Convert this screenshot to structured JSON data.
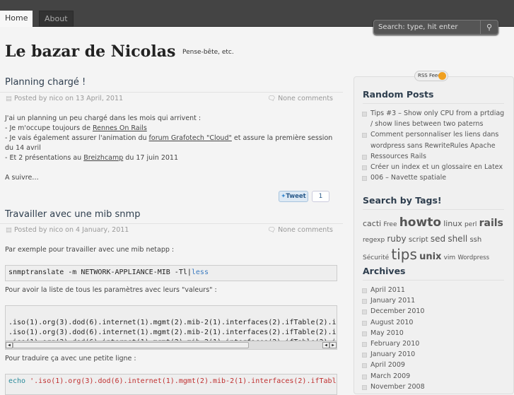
{
  "nav": {
    "tabs": [
      {
        "label": "Home",
        "active": true
      },
      {
        "label": "About"
      }
    ]
  },
  "search": {
    "placeholder": "Search: type, hit enter",
    "icon": "search-icon"
  },
  "site": {
    "title": "Le bazar de Nicolas",
    "tagline": "Pense-bête, etc."
  },
  "posts": [
    {
      "title": "Planning chargé !",
      "meta": "Posted by nico on 13 April, 2011",
      "comments": "None comments",
      "p1": "J'ai un planning un peu chargé dans les mois qui arrivent :",
      "l1a": "- Je m'occupe toujours de ",
      "l1link": "Rennes On Rails",
      "l2a": "- Je vais également assurer l'animation du ",
      "l2link": "forum Grafotech \"Cloud\"",
      "l2b": " et assure la première session du 14 avril",
      "l3a": "- Et 2 présentations au ",
      "l3link": "Breizhcamp",
      "l3b": " du 17 juin 2011",
      "p2": "A suivre…",
      "tweet": "Tweet",
      "tweet_count": "1"
    },
    {
      "title": "Travailler avec une mib snmp",
      "meta": "Posted by nico on 4 January, 2011",
      "comments": "None comments",
      "p1": "Par exemple pour travailler avec une mib netapp :",
      "code1a": "snmptranslate -m NETWORK-APPLIANCE-MIB -Tl|",
      "code1b": "less",
      "p2": "Pour avoir la liste de tous les paramètres avec leurs \"valeurs\" :",
      "code2": [
        ".iso(1).org(3).dod(6).internet(1).mgmt(2).mib-2(1).interfaces(2).ifTable(2).i",
        ".iso(1).org(3).dod(6).internet(1).mgmt(2).mib-2(1).interfaces(2).ifTable(2).i",
        ".iso(1).org(3).dod(6).internet(1).mgmt(2).mib-2(1).interfaces(2).ifTable(2).i"
      ],
      "p3": "Pour traduire ça avec une petite ligne :",
      "code3a": "echo ",
      "code3b": "'.iso(1).org(3).dod(6).internet(1).mgmt(2).mib-2(1).interfaces(2).ifTabl"
    }
  ],
  "sidebar": {
    "rss": "RSS Feed",
    "random_title": "Random Posts",
    "random": [
      "Tips #3 – Show only CPU from a prtdiag / show lines between two paterns",
      "Comment personnaliser les liens dans wordpress sans RewriteRules Apache",
      "Ressources Rails",
      "Créer un index et un glossaire en Latex",
      "006 – Navette spatiale"
    ],
    "tags_title": "Search by Tags!",
    "tags": [
      {
        "t": "cacti",
        "s": 11
      },
      {
        "t": "Free",
        "s": 9
      },
      {
        "t": "howto",
        "s": 17
      },
      {
        "t": "linux",
        "s": 11
      },
      {
        "t": "perl",
        "s": 9
      },
      {
        "t": "rails",
        "s": 14
      },
      {
        "t": "regexp",
        "s": 9
      },
      {
        "t": "ruby",
        "s": 12
      },
      {
        "t": "script",
        "s": 10
      },
      {
        "t": "sed",
        "s": 12
      },
      {
        "t": "shell",
        "s": 12
      },
      {
        "t": "ssh",
        "s": 10
      },
      {
        "t": "Sécurité",
        "s": 9
      },
      {
        "t": "tips",
        "s": 20
      },
      {
        "t": "unix",
        "s": 13
      },
      {
        "t": "vim",
        "s": 9
      },
      {
        "t": "Wordpress",
        "s": 8.5
      }
    ],
    "archives_title": "Archives",
    "archives": [
      "April 2011",
      "January 2011",
      "December 2010",
      "August 2010",
      "May 2010",
      "February 2010",
      "January 2010",
      "April 2009",
      "March 2009",
      "November 2008"
    ]
  }
}
